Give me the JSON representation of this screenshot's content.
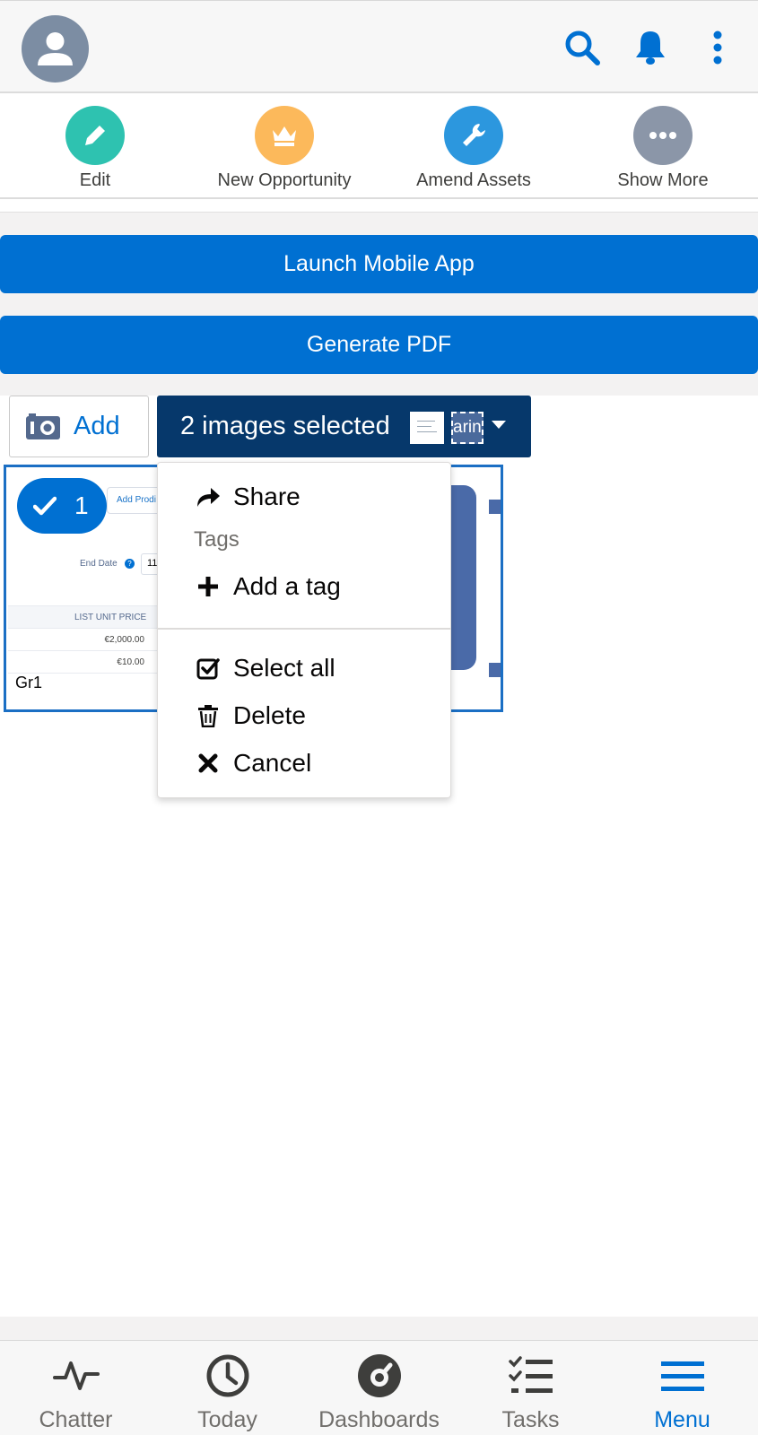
{
  "header": {
    "avatar_icon": "user-avatar-icon",
    "search_icon": "search-icon",
    "notifications_icon": "bell-icon",
    "overflow_icon": "more-vertical-icon",
    "accent_color": "#0070d2"
  },
  "actions": [
    {
      "label": "Edit",
      "icon": "pencil-icon",
      "color": "#2ec2b0"
    },
    {
      "label": "New Opportunity",
      "icon": "crown-icon",
      "color": "#fcb95b"
    },
    {
      "label": "Amend Assets",
      "icon": "wrench-icon",
      "color": "#2c97de"
    },
    {
      "label": "Show More",
      "icon": "more-horizontal-icon",
      "color": "#8b96a8"
    }
  ],
  "buttons": {
    "launch": "Launch Mobile App",
    "pdf": "Generate PDF"
  },
  "toolbar": {
    "add_label": "Add",
    "selected_label": "2 images selected",
    "thumb_text": "arin"
  },
  "card": {
    "badge_count": "1",
    "label": "Gr1",
    "snapshot": {
      "button_text": "Add Prodi",
      "end_date_label": "End Date",
      "date_value": "11",
      "column_header": "LIST UNIT PRICE",
      "rows": [
        "€2,000.00",
        "€10.00"
      ]
    }
  },
  "menu": {
    "share": "Share",
    "tags_heading": "Tags",
    "add_tag": "Add a tag",
    "select_all": "Select all",
    "delete": "Delete",
    "cancel": "Cancel"
  },
  "tabs": [
    {
      "label": "Chatter",
      "icon": "pulse-icon",
      "active": false
    },
    {
      "label": "Today",
      "icon": "clock-icon",
      "active": false
    },
    {
      "label": "Dashboards",
      "icon": "gauge-icon",
      "active": false
    },
    {
      "label": "Tasks",
      "icon": "checklist-icon",
      "active": false
    },
    {
      "label": "Menu",
      "icon": "hamburger-icon",
      "active": true
    }
  ]
}
